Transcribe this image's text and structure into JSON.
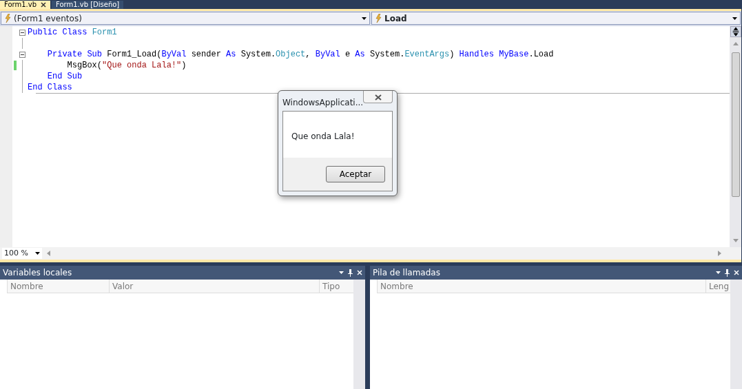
{
  "document_tabs": [
    {
      "label": "Form1.vb",
      "selected": true,
      "closable": true
    },
    {
      "label": "Form1.vb [Diseño]",
      "selected": false,
      "closable": false
    }
  ],
  "dropdowns": [
    {
      "text": "(Form1 eventos)",
      "bold": false
    },
    {
      "text": "Load",
      "bold": true
    }
  ],
  "editor": {
    "lines": [
      {
        "collapsible": true,
        "changed": false,
        "tokens": [
          {
            "kind": "keyword",
            "text": "Public Class "
          },
          {
            "kind": "type",
            "text": "Form1"
          }
        ]
      },
      {
        "collapsible": false,
        "changed": false
      },
      {
        "collapsible": true,
        "changed": false,
        "tokens": [
          {
            "kind": "keyword",
            "text": "    Private Sub "
          },
          {
            "kind": "plain",
            "text": "Form1_Load("
          },
          {
            "kind": "keyword",
            "text": "ByVal "
          },
          {
            "kind": "plain",
            "text": "sender "
          },
          {
            "kind": "keyword",
            "text": "As "
          },
          {
            "kind": "plain",
            "text": "System."
          },
          {
            "kind": "type",
            "text": "Object"
          },
          {
            "kind": "plain",
            "text": ", "
          },
          {
            "kind": "keyword",
            "text": "ByVal "
          },
          {
            "kind": "plain",
            "text": "e "
          },
          {
            "kind": "keyword",
            "text": "As "
          },
          {
            "kind": "plain",
            "text": "System."
          },
          {
            "kind": "type",
            "text": "EventArgs"
          },
          {
            "kind": "plain",
            "text": ") "
          },
          {
            "kind": "keyword",
            "text": "Handles MyBase"
          },
          {
            "kind": "plain",
            "text": ".Load"
          }
        ]
      },
      {
        "collapsible": false,
        "changed": true,
        "tokens": [
          {
            "kind": "plain",
            "text": "        MsgBox("
          },
          {
            "kind": "string",
            "text": "\"Que onda Lala!\""
          },
          {
            "kind": "plain",
            "text": ")"
          }
        ]
      },
      {
        "collapsible": false,
        "changed": false,
        "tokens": [
          {
            "kind": "keyword",
            "text": "    End Sub"
          }
        ]
      },
      {
        "collapsible": false,
        "changed": false,
        "tokens": [
          {
            "kind": "keyword",
            "text": "End Class"
          }
        ]
      }
    ],
    "zoom": "100 %"
  },
  "dialog": {
    "title": "WindowsApplicati...",
    "message": "Que onda Lala!",
    "button": "Aceptar"
  },
  "panels": [
    {
      "title": "Variables locales",
      "columns": [
        "Nombre",
        "Valor",
        "Tipo"
      ]
    },
    {
      "title": "Pila de llamadas",
      "columns": [
        "Nombre",
        "Leng"
      ]
    }
  ]
}
